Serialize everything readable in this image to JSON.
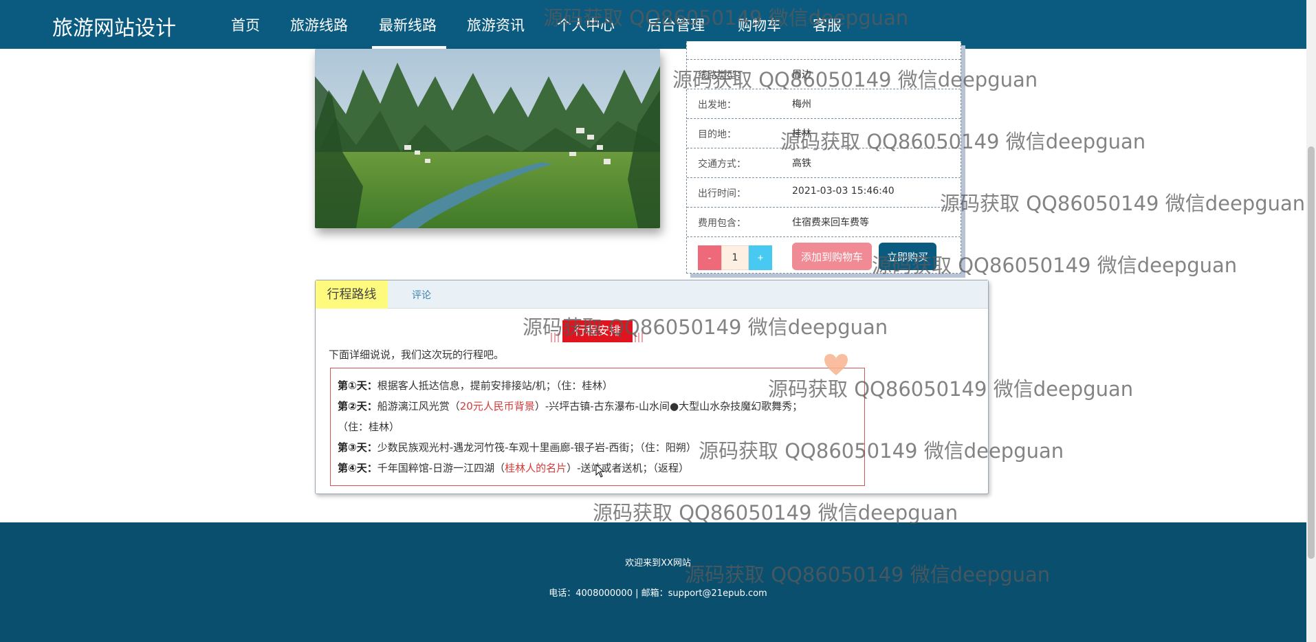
{
  "nav": {
    "brand": "旅游网站设计",
    "items": [
      "首页",
      "旅游线路",
      "最新线路",
      "旅游资讯",
      "个人中心",
      "后台管理",
      "购物车",
      "客服"
    ],
    "active": "最新线路"
  },
  "info": {
    "rows": [
      {
        "label": "线路类型：",
        "value": "周边"
      },
      {
        "label": "出发地：",
        "value": "梅州"
      },
      {
        "label": "目的地：",
        "value": "桂林"
      },
      {
        "label": "交通方式：",
        "value": "高铁"
      },
      {
        "label": "出行时间：",
        "value": "2021-03-03 15:46:40"
      },
      {
        "label": "费用包含：",
        "value": "住宿费来回车费等"
      }
    ],
    "minus": "-",
    "quantity": "1",
    "plus": "+",
    "add_cart": "添加到购物车",
    "buy_now": "立即购买"
  },
  "tabs": {
    "route": "行程路线",
    "comment": "评论"
  },
  "schedule": {
    "title": "行程安排",
    "intro": "下面详细说说，我们这次玩的行程吧。",
    "days": [
      {
        "label": "第①天：",
        "text": "根据客人抵达信息，提前安排接站/机；（住：桂林）"
      },
      {
        "label": "第②天：",
        "pre": "船游漓江风光赏（",
        "highlight": "20元人民币背景",
        "post": "）-兴坪古镇-古东瀑布-山水间●大型山水杂技魔幻歌舞秀；"
      },
      {
        "label": "",
        "text": "（住：桂林）"
      },
      {
        "label": "第③天：",
        "text": "少数民族观光村-遇龙河竹筏-车观十里画廊-银子岩-西街；（住：阳朔）"
      },
      {
        "label": "第④天：",
        "pre": "千年国粹馆-日游一江四湖（",
        "highlight": "桂林人的名片",
        "post": "）-送站或者送机；（返程）"
      }
    ]
  },
  "footer": {
    "welcome": "欢迎来到XX网站",
    "contact": "电话：4008000000 | 邮箱：support@21epub.com"
  },
  "watermark": "源码获取 QQ86050149 微信deepguan",
  "colors": {
    "nav_bg": "#0b5b80",
    "footer_bg": "#0b4f6f",
    "add_cart": "#f08a95",
    "buy": "#0b5b80",
    "highlight": "#d63b3b"
  }
}
